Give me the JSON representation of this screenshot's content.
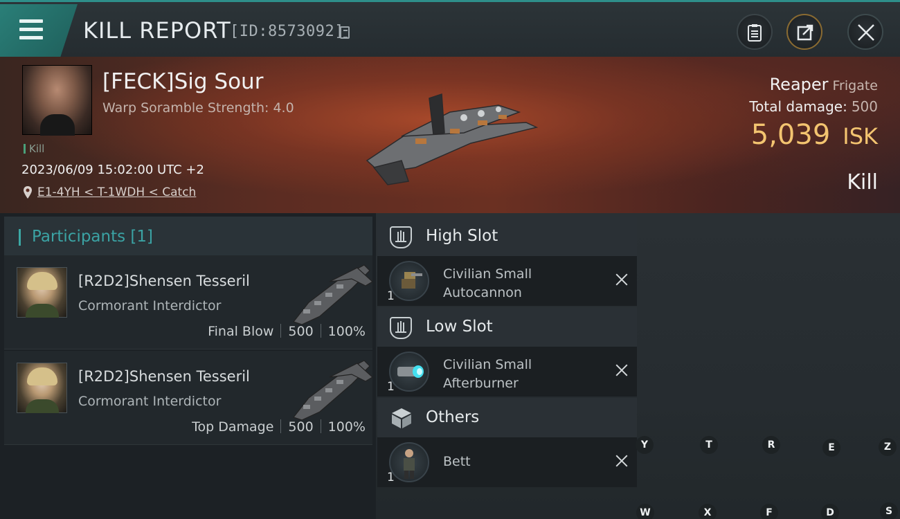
{
  "header": {
    "title": "KILL REPORT",
    "report_id": "[ID:8573092]"
  },
  "victim": {
    "name": "[FECK]Sig Sour",
    "subtitle": "Warp Soramble Strength: 4.0",
    "tag": "Kill",
    "timestamp": "2023/06/09 15:02:00 UTC +2",
    "location": "E1-4YH < T-1WDH < Catch",
    "ship_name": "Reaper",
    "ship_class": "Frigate",
    "total_damage_label": "Total damage:",
    "total_damage_value": "500",
    "isk_value": "5,039",
    "isk_unit": "ISK",
    "result": "Kill"
  },
  "participants": {
    "title": "Participants [1]",
    "rows": [
      {
        "name": "[R2D2]Shensen Tesseril",
        "ship": "Cormorant Interdictor",
        "role": "Final Blow",
        "damage": "500",
        "percent": "100%"
      },
      {
        "name": "[R2D2]Shensen Tesseril",
        "ship": "Cormorant Interdictor",
        "role": "Top Damage",
        "damage": "500",
        "percent": "100%"
      }
    ]
  },
  "fitting": {
    "sections": [
      {
        "title": "High Slot",
        "item_lines": [
          "Civilian Small",
          "Autocannon"
        ],
        "qty": "1"
      },
      {
        "title": "Low Slot",
        "item_lines": [
          "Civilian Small",
          "Afterburner"
        ],
        "qty": "1"
      },
      {
        "title": "Others",
        "item_lines": [
          "Bett"
        ],
        "qty": "1"
      }
    ]
  },
  "keyboard_hints": {
    "row1": [
      "Y",
      "T",
      "R",
      "E",
      "Z"
    ],
    "row2": [
      "W",
      "X",
      "F",
      "D",
      "S"
    ]
  },
  "colors": {
    "accent": "#2e8f8a",
    "isk": "#f3c470",
    "participants_title": "#3ba3a4"
  }
}
